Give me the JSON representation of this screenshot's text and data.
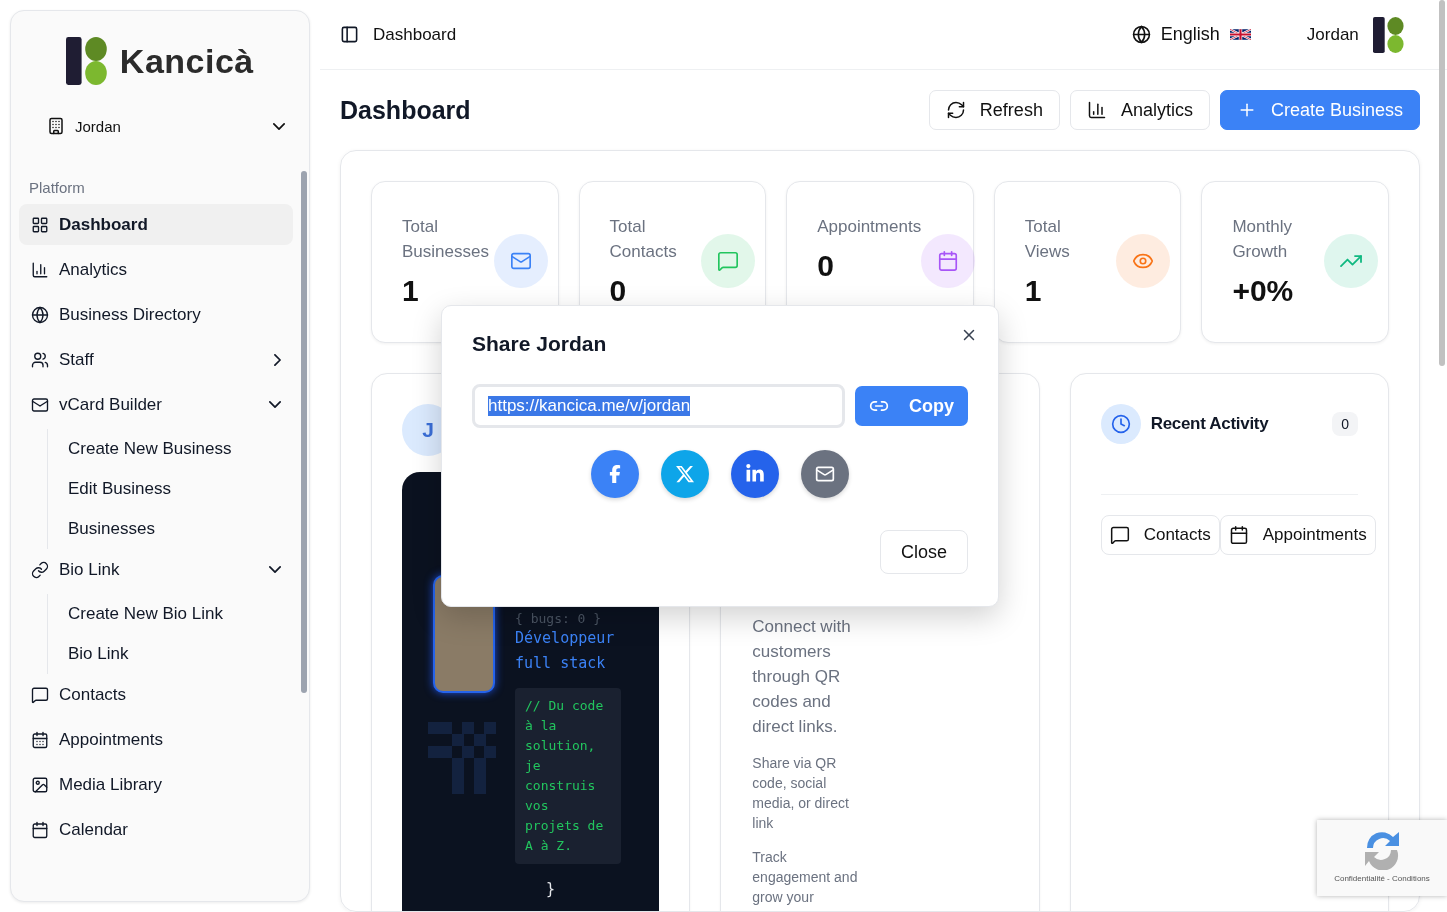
{
  "sidebar": {
    "brand": "Kancicà",
    "account": "Jordan",
    "section": "Platform",
    "items": [
      {
        "label": "Dashboard",
        "selected": true
      },
      {
        "label": "Analytics",
        "selected": false
      },
      {
        "label": "Business Directory",
        "selected": false
      },
      {
        "label": "Staff",
        "selected": false,
        "expanded": false
      },
      {
        "label": "vCard Builder",
        "selected": false,
        "expanded": true,
        "children": [
          {
            "label": "Create New Business"
          },
          {
            "label": "Edit Business"
          },
          {
            "label": "Businesses"
          }
        ]
      },
      {
        "label": "Bio Link",
        "selected": false,
        "expanded": true,
        "children": [
          {
            "label": "Create New Bio Link"
          },
          {
            "label": "Bio Link"
          }
        ]
      },
      {
        "label": "Contacts",
        "selected": false
      },
      {
        "label": "Appointments",
        "selected": false
      },
      {
        "label": "Media Library",
        "selected": false
      },
      {
        "label": "Calendar",
        "selected": false
      }
    ]
  },
  "header": {
    "breadcrumb": "Dashboard",
    "language": "English",
    "user": "Jordan"
  },
  "page": {
    "title": "Dashboard",
    "actions": [
      {
        "label": "Refresh",
        "kind": "outline"
      },
      {
        "label": "Analytics",
        "kind": "outline"
      },
      {
        "label": "Create Business",
        "kind": "primary"
      }
    ]
  },
  "stats": [
    {
      "label": "Total Businesses",
      "value": "1",
      "color": "#3b82f6"
    },
    {
      "label": "Total Contacts",
      "value": "0",
      "color": "#22c55e"
    },
    {
      "label": "Appointments",
      "value": "0",
      "color": "#a855f7"
    },
    {
      "label": "Total Views",
      "value": "1",
      "color": "#f97316"
    },
    {
      "label": "Monthly Growth",
      "value": "+0%",
      "color": "#10b981"
    }
  ],
  "profile_card": {
    "avatar": "J",
    "tagline": "{ bugs: 0 }",
    "role": "Développeur full stack",
    "code": "// Du code à la solution, je construis vos projets de A à Z.",
    "closing": "}"
  },
  "share_info": {
    "paragraphs": [
      {
        "kind": "lead",
        "text": "Connect with customers through QR codes and direct links."
      },
      {
        "kind": "small",
        "text": "Share via QR code, social media, or direct link"
      },
      {
        "kind": "small",
        "text": "Track engagement and grow your"
      }
    ]
  },
  "recent_activity": {
    "title": "Recent Activity",
    "count": "0",
    "buttons": [
      {
        "label": "Contacts"
      },
      {
        "label": "Appointments"
      }
    ]
  },
  "share_dialog": {
    "title": "Share Jordan",
    "url": "https://kancica.me/v/jordan",
    "url_selected": true,
    "copy": "Copy",
    "networks": [
      {
        "kind": "facebook",
        "color": "#3b82f6"
      },
      {
        "kind": "x",
        "color": "#0ea5e9"
      },
      {
        "kind": "linkedin",
        "color": "#2563eb"
      },
      {
        "kind": "email",
        "color": "#6b7280"
      }
    ],
    "close": "Close"
  },
  "recaptcha": {
    "links": "Confidentialité - Conditions"
  }
}
